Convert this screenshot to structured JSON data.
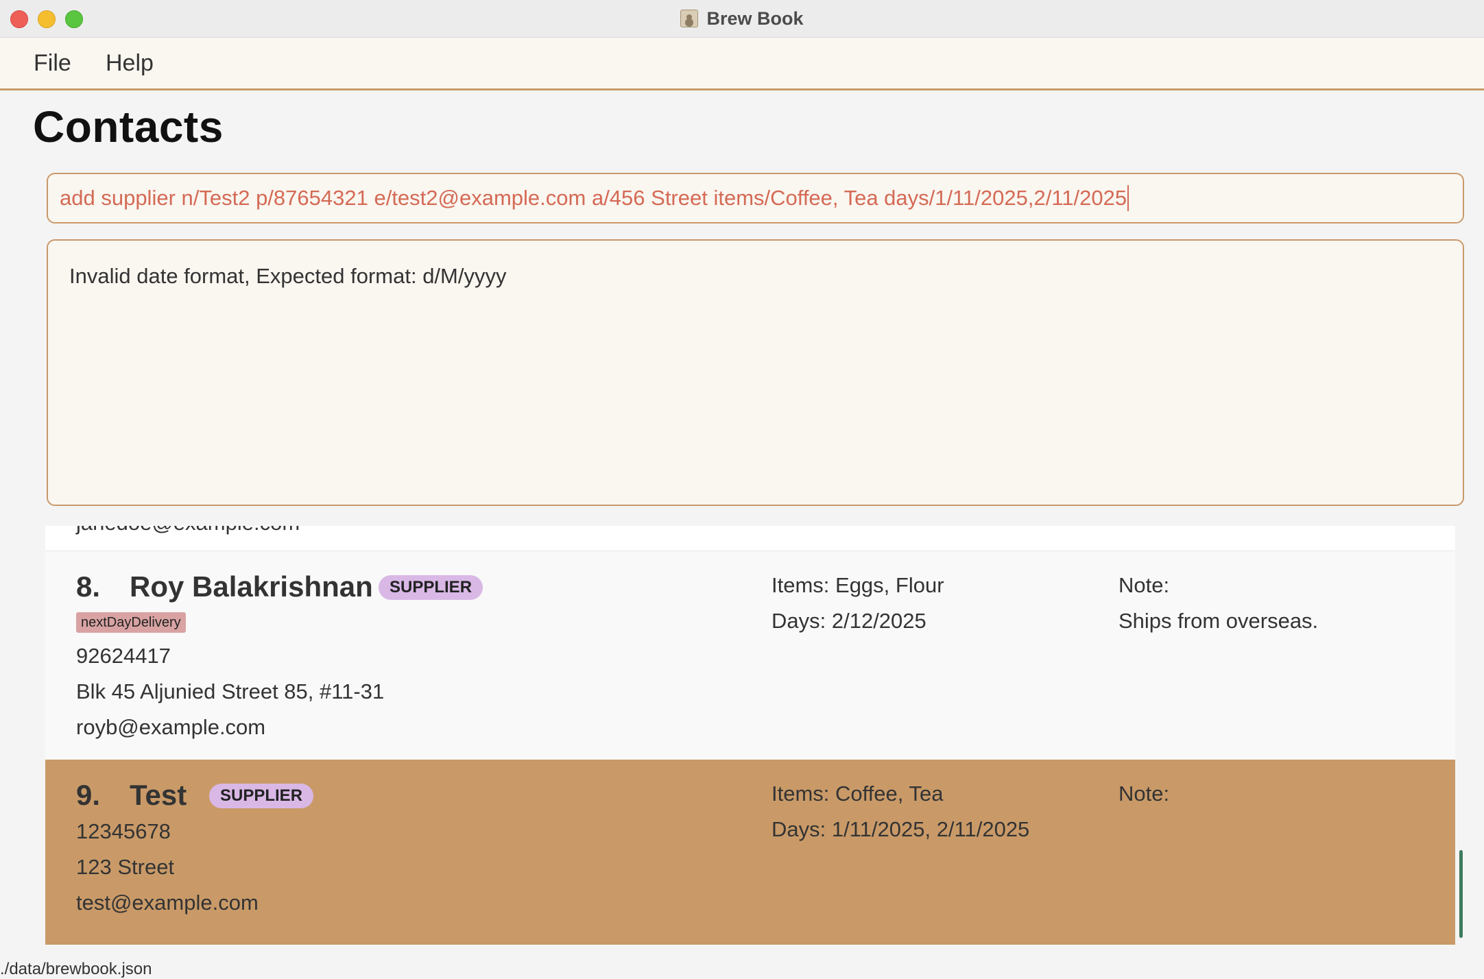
{
  "window": {
    "title": "Brew Book",
    "app_icon": "address-book-icon"
  },
  "menu": {
    "file": "File",
    "help": "Help"
  },
  "page_title": "Contacts",
  "command": {
    "value": "add supplier n/Test2 p/87654321 e/test2@example.com a/456 Street items/Coffee, Tea days/1/11/2025,2/11/2025"
  },
  "result": {
    "message": "Invalid date format, Expected format: d/M/yyyy"
  },
  "contacts": [
    {
      "email_partial": "janedoe@example.com"
    },
    {
      "index": "8.",
      "name": "Roy Balakrishnan",
      "role": "SUPPLIER",
      "tag": "nextDayDelivery",
      "phone": "92624417",
      "address": "Blk 45 Aljunied Street 85, #11-31",
      "email": "royb@example.com",
      "items": "Items:  Eggs, Flour",
      "days": "Days:  2/12/2025",
      "note_label": "Note:",
      "note": "Ships from overseas."
    },
    {
      "index": "9.",
      "name": "Test",
      "role": "SUPPLIER",
      "phone": "12345678",
      "address": "123 Street",
      "email": "test@example.com",
      "items": "Items:  Coffee, Tea",
      "days": "Days:  1/11/2025, 2/11/2025",
      "note_label": "Note:",
      "selected": true
    }
  ],
  "status": {
    "path": "./data/brewbook.json"
  },
  "colors": {
    "accent": "#c9996a",
    "selected_card": "#c99a68",
    "command_text": "#d46a55",
    "supplier_badge": "#d9b8e6",
    "tag": "#d9a3a3",
    "scroll_thumb": "#3e7b5c"
  }
}
